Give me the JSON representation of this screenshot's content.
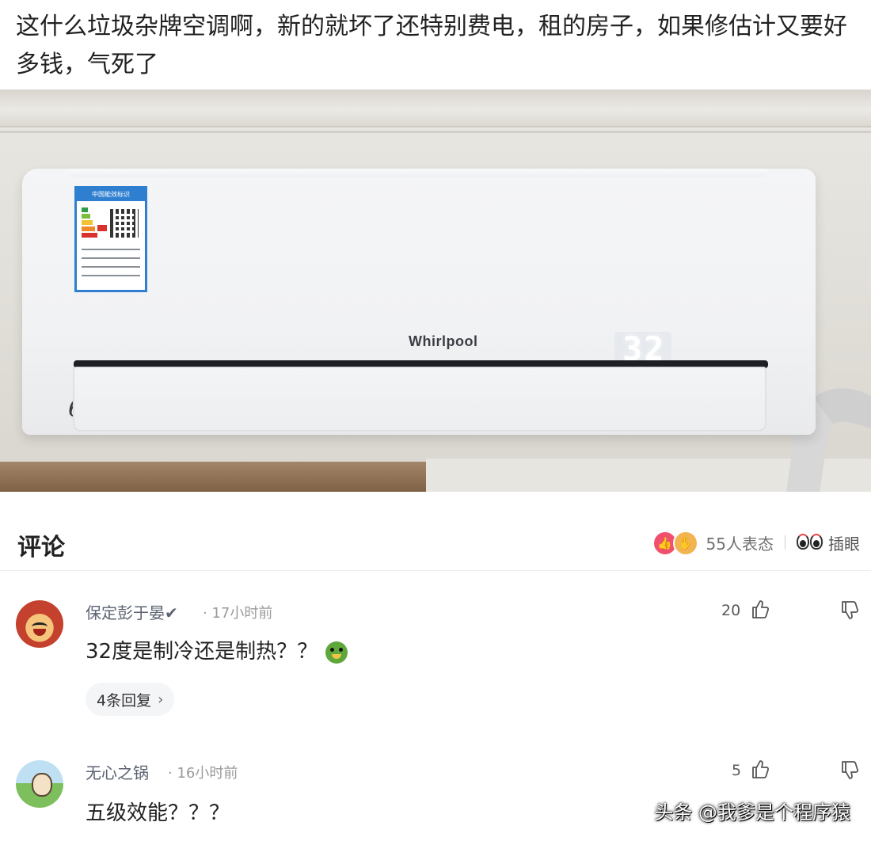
{
  "post": {
    "text": "这什么垃圾杂牌空调啊，新的就坏了还特别费电，租的房子，如果修估计又要好多钱，气死了"
  },
  "photo": {
    "brand": "Whirlpool",
    "display_value": "32",
    "energy_label_head": "中国能效标识",
    "model_mark": "6"
  },
  "comments_section": {
    "title": "评论",
    "reaction_count": "55人表态",
    "eyes_label": "插眼",
    "reaction_icons": [
      "like-icon",
      "hand-clap-icon"
    ]
  },
  "comments": [
    {
      "user": "保定彭于晏✔",
      "time": "· 17小时前",
      "text": "32度是制冷还是制热？？",
      "likes": "20",
      "replies": "4条回复",
      "emoji": "green-grimace-emoji"
    },
    {
      "user": "无心之锅",
      "time": "· 16小时前",
      "text": "五级效能？？？",
      "likes": "5"
    }
  ],
  "watermark": "头条 @我爹是个程序猿",
  "colors": {
    "like_pink": "#f0506e",
    "label_blue": "#2f7fd1"
  }
}
